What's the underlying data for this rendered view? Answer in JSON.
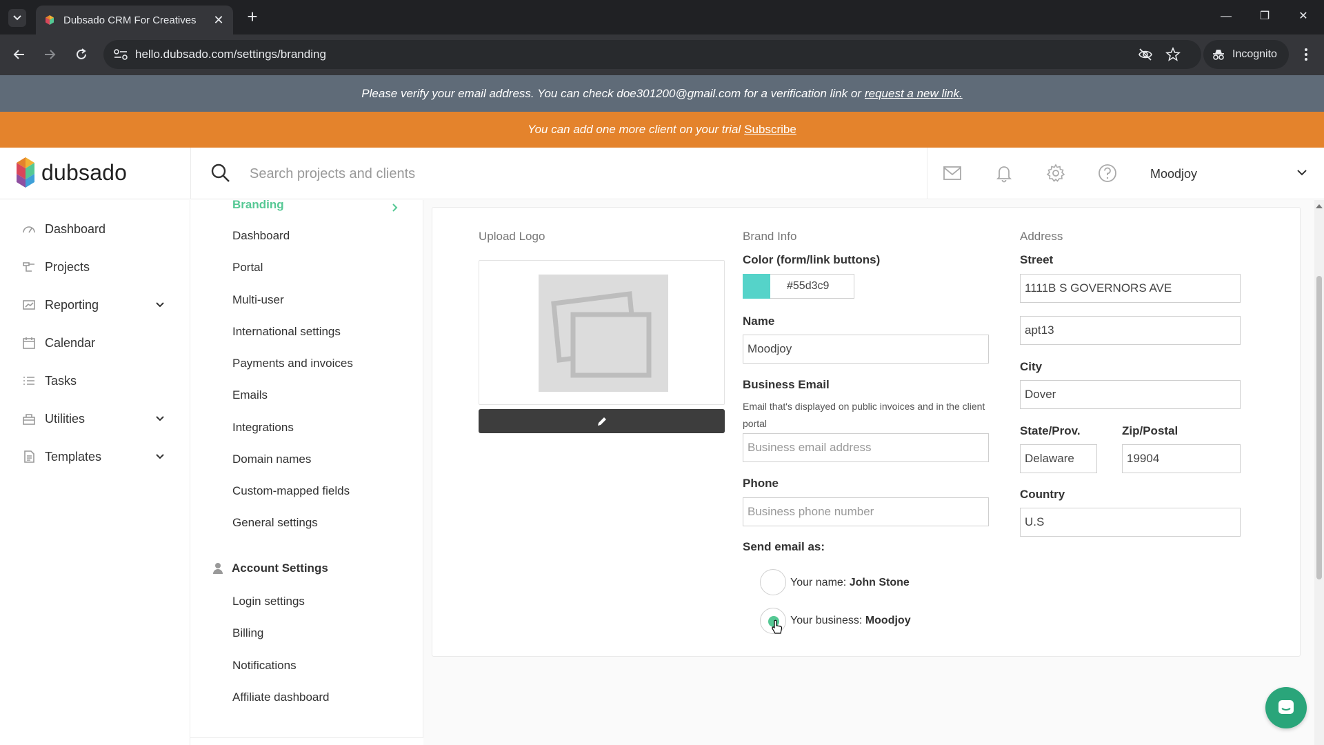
{
  "browser": {
    "tab_title": "Dubsado CRM For Creatives",
    "url": "hello.dubsado.com/settings/branding",
    "profile_label": "Incognito"
  },
  "banners": {
    "verify_text": "Please verify your email address. You can check doe301200@gmail.com for a verification link or",
    "verify_link": "request a new link.",
    "trial_text": "You can add one more client on your trial",
    "trial_link": "Subscribe"
  },
  "header": {
    "logo_text": "dubsado",
    "search_placeholder": "Search projects and clients",
    "account_name": "Moodjoy"
  },
  "sidebar": {
    "items": [
      {
        "label": "Dashboard",
        "icon": "dashboard-icon"
      },
      {
        "label": "Projects",
        "icon": "projects-icon"
      },
      {
        "label": "Reporting",
        "icon": "reporting-icon",
        "expandable": true
      },
      {
        "label": "Calendar",
        "icon": "calendar-icon"
      },
      {
        "label": "Tasks",
        "icon": "tasks-icon"
      },
      {
        "label": "Utilities",
        "icon": "utilities-icon",
        "expandable": true
      },
      {
        "label": "Templates",
        "icon": "templates-icon",
        "expandable": true
      }
    ]
  },
  "subnav": {
    "active": "Branding",
    "items": [
      "Dashboard",
      "Portal",
      "Multi-user",
      "International settings",
      "Payments and invoices",
      "Emails",
      "Integrations",
      "Domain names",
      "Custom-mapped fields",
      "General settings"
    ],
    "account_section": "Account Settings",
    "account_items": [
      "Login settings",
      "Billing",
      "Notifications",
      "Affiliate dashboard"
    ]
  },
  "branding": {
    "upload_logo_label": "Upload Logo",
    "brand_info_label": "Brand Info",
    "color_label": "Color (form/link buttons)",
    "color_value": "#55d3c9",
    "name_label": "Name",
    "name_value": "Moodjoy",
    "business_email_label": "Business Email",
    "business_email_help": "Email that's displayed on public invoices and in the client portal",
    "business_email_placeholder": "Business email address",
    "phone_label": "Phone",
    "phone_placeholder": "Business phone number",
    "send_as_label": "Send email as:",
    "send_as_name_prefix": "Your name:",
    "send_as_name_value": "John Stone",
    "send_as_business_prefix": "Your business:",
    "send_as_business_value": "Moodjoy",
    "send_as_selected": "business"
  },
  "address": {
    "section_label": "Address",
    "street_label": "Street",
    "street_value": "1111B S GOVERNORS AVE",
    "street2_value": "apt13",
    "city_label": "City",
    "city_value": "Dover",
    "state_label": "State/Prov.",
    "state_value": "Delaware",
    "zip_label": "Zip/Postal",
    "zip_value": "19904",
    "country_label": "Country",
    "country_value": "U.S"
  },
  "colors": {
    "accent": "#55c894",
    "brand_color": "#55d3c9",
    "trial_banner": "#e4832c",
    "verify_banner": "#5f6b78"
  }
}
